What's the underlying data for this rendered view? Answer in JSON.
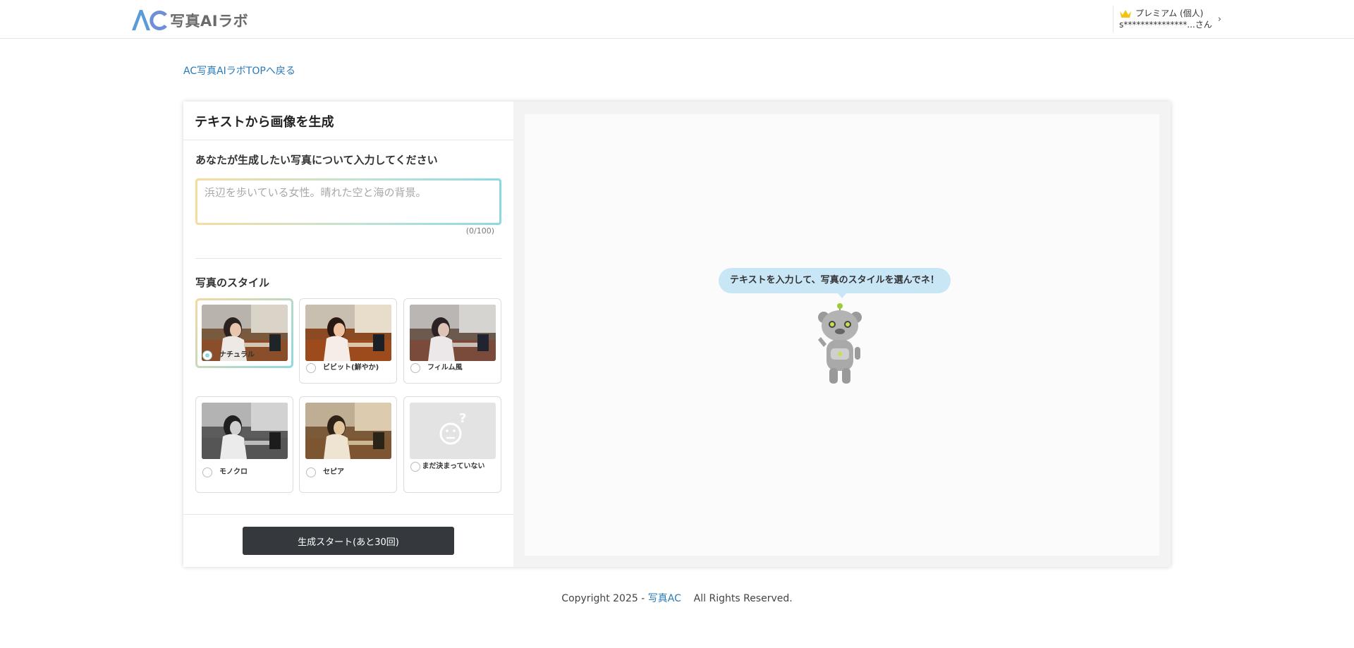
{
  "header": {
    "logo_text": "写真AIラボ",
    "plan_label": "プレミアム (個人)",
    "user_name": "s***************...さん",
    "chevron": "›"
  },
  "back_link": "AC写真AIラボTOPへ戻る",
  "panel": {
    "title": "テキストから画像を生成",
    "prompt_label": "あなたが生成したい写真について入力してください",
    "prompt_placeholder": "浜辺を歩いている女性。晴れた空と海の背景。",
    "prompt_value": "",
    "counter": "(0/100)",
    "style_label": "写真のスタイル",
    "styles": [
      {
        "name": "ナチュラル",
        "selected": true
      },
      {
        "name": "ビビット(鮮やか)",
        "selected": false
      },
      {
        "name": "フィルム風",
        "selected": false
      },
      {
        "name": "モノクロ",
        "selected": false
      },
      {
        "name": "セピア",
        "selected": false
      },
      {
        "name": "まだ決まっていない",
        "selected": false
      }
    ],
    "generate_button": "生成スタート(あと30回)"
  },
  "preview": {
    "bubble_text": "テキストを入力して、写真のスタイルを選んでネ！"
  },
  "footer": {
    "prefix": "Copyright 2025 - ",
    "link": "写真AC",
    "suffix": "All Rights Reserved."
  },
  "colors": {
    "brand_blue": "#5c8fd6",
    "button_dark": "#35383d",
    "bubble_blue": "#c9e6f7",
    "link_blue": "#2a7ab8"
  }
}
